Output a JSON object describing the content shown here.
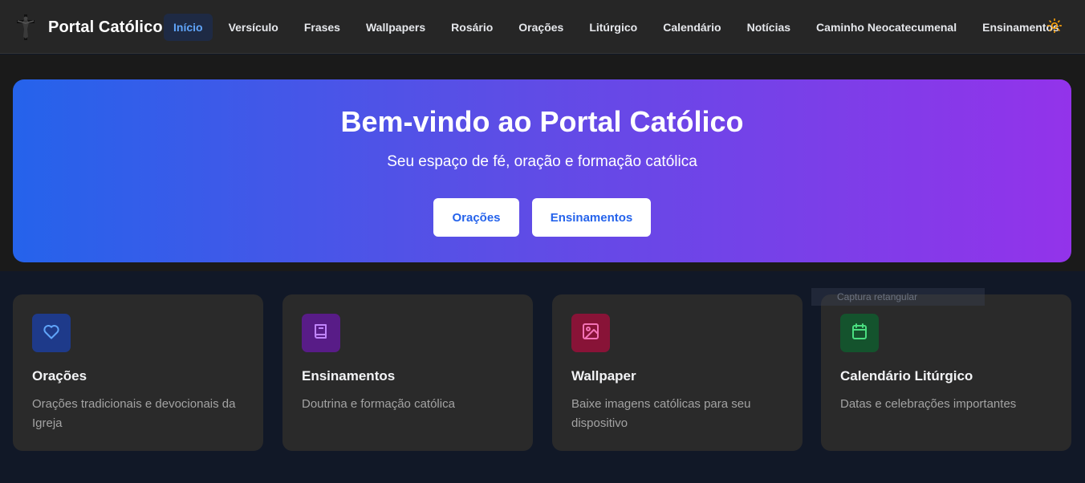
{
  "header": {
    "brand_title": "Portal Católico",
    "nav": [
      {
        "label": "Início",
        "active": true
      },
      {
        "label": "Versículo"
      },
      {
        "label": "Frases"
      },
      {
        "label": "Wallpapers"
      },
      {
        "label": "Rosário"
      },
      {
        "label": "Orações"
      },
      {
        "label": "Litúrgico"
      },
      {
        "label": "Calendário"
      },
      {
        "label": "Notícias"
      },
      {
        "label": "Caminho Neocatecumenal"
      },
      {
        "label": "Ensinamentos"
      }
    ],
    "theme_icon": "sun-icon"
  },
  "hero": {
    "title": "Bem-vindo ao Portal Católico",
    "subtitle": "Seu espaço de fé, oração e formação católica",
    "buttons": [
      "Orações",
      "Ensinamentos"
    ]
  },
  "cards": [
    {
      "title": "Orações",
      "desc": "Orações tradicionais e devocionais da Igreja",
      "icon": "heart-icon",
      "icon_bg": "#1e3a8a",
      "icon_color": "#60a5fa"
    },
    {
      "title": "Ensinamentos",
      "desc": "Doutrina e formação católica",
      "icon": "book-icon",
      "icon_bg": "#581c87",
      "icon_color": "#c084fc"
    },
    {
      "title": "Wallpaper",
      "desc": "Baixe imagens católicas para seu dispositivo",
      "icon": "image-icon",
      "icon_bg": "#881337",
      "icon_color": "#f472b6"
    },
    {
      "title": "Calendário Litúrgico",
      "desc": "Datas e celebrações importantes",
      "icon": "calendar-icon",
      "icon_bg": "#14532d",
      "icon_color": "#4ade80"
    }
  ],
  "overlay": {
    "text": "Captura retangular"
  },
  "colors": {
    "accent": "#2563eb",
    "nav_active": "#60a5fa",
    "sun": "#f59e0b"
  }
}
